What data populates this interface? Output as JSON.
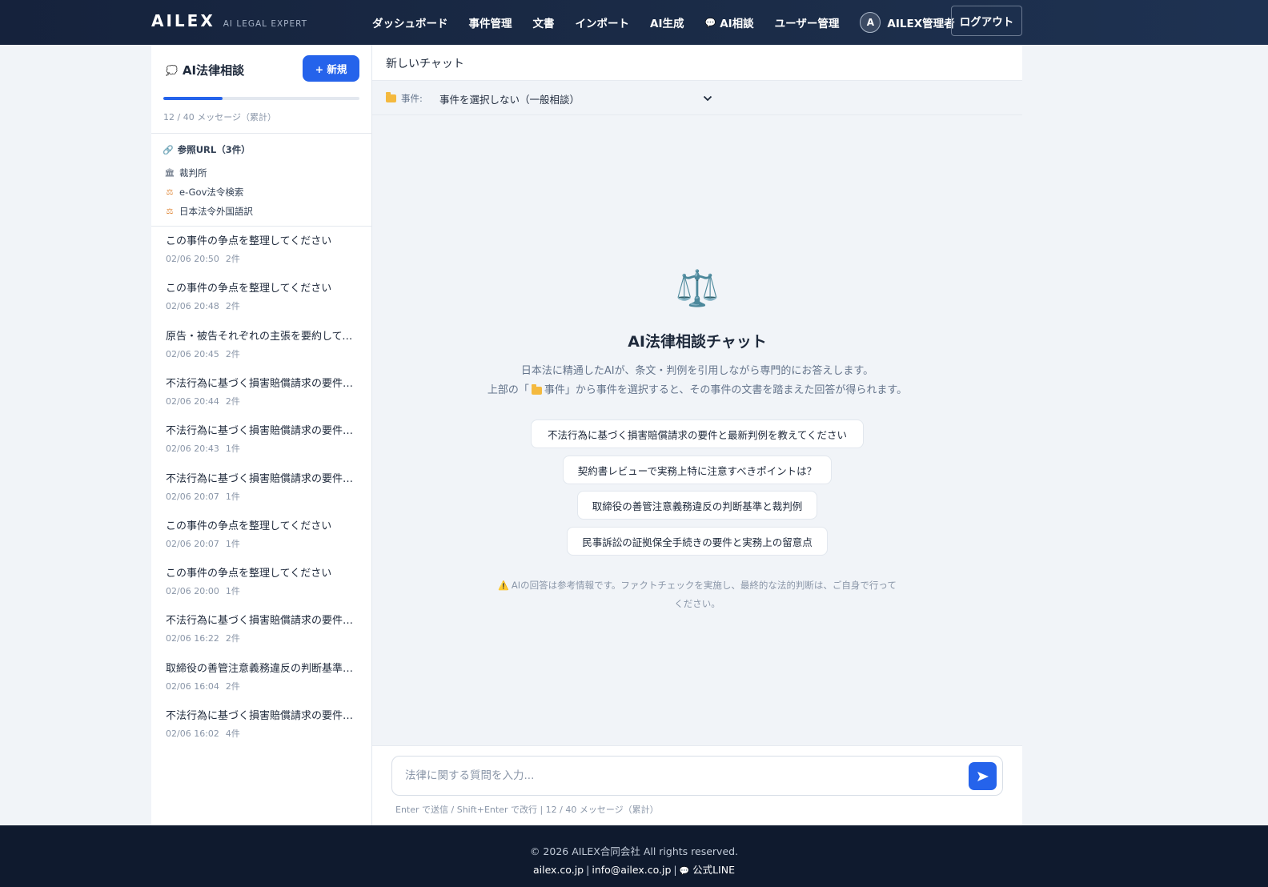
{
  "header": {
    "logo": "AILEX",
    "tagline": "AI LEGAL EXPERT",
    "nav": [
      "ダッシュボード",
      "事件管理",
      "文書",
      "インポート",
      "AI生成",
      "AI相談",
      "ユーザー管理"
    ],
    "user": {
      "initial": "A",
      "name": "AILEX管理者"
    },
    "logout": "ログアウト"
  },
  "sidebar": {
    "title": "AI法律相談",
    "new_button": "+ 新規",
    "usage": {
      "used": 12,
      "limit": 40,
      "progress": 0.3,
      "text": "12 / 40 メッセージ（累計）"
    },
    "refs_title": "参照URL（3件）",
    "refs": [
      {
        "label": "裁判所",
        "icon": "court-icon"
      },
      {
        "label": "e-Gov法令検索",
        "icon": "law-icon"
      },
      {
        "label": "日本法令外国語訳",
        "icon": "law-icon"
      }
    ],
    "history": [
      {
        "title": "この事件の争点を整理してください",
        "time": "02/06 20:50",
        "count": "2件"
      },
      {
        "title": "この事件の争点を整理してください",
        "time": "02/06 20:48",
        "count": "2件"
      },
      {
        "title": "原告・被告それぞれの主張を要約してください",
        "time": "02/06 20:45",
        "count": "2件"
      },
      {
        "title": "不法行為に基づく損害賠償請求の要件と最新判例を教えてください",
        "time": "02/06 20:44",
        "count": "2件"
      },
      {
        "title": "不法行為に基づく損害賠償請求の要件と最新判例を教えてください",
        "time": "02/06 20:43",
        "count": "1件"
      },
      {
        "title": "不法行為に基づく損害賠償請求の要件と最新判例を教えてください",
        "time": "02/06 20:07",
        "count": "1件"
      },
      {
        "title": "この事件の争点を整理してください",
        "time": "02/06 20:07",
        "count": "1件"
      },
      {
        "title": "この事件の争点を整理してください",
        "time": "02/06 20:00",
        "count": "1件"
      },
      {
        "title": "不法行為に基づく損害賠償請求の要件と最新判例を教えてください",
        "time": "02/06 16:22",
        "count": "2件"
      },
      {
        "title": "取締役の善管注意義務違反の判断基準と裁判例",
        "time": "02/06 16:04",
        "count": "2件"
      },
      {
        "title": "不法行為に基づく損害賠償請求の要件と最新判例を教えてください",
        "time": "02/06 16:02",
        "count": "4件"
      }
    ]
  },
  "main": {
    "chat_title": "新しいチャット",
    "case_label": "事件:",
    "case_selected": "事件を選択しない（一般相談）",
    "welcome_title": "AI法律相談チャット",
    "welcome_line1": "日本法に精通したAIが、条文・判例を引用しながら専門的にお答えします。",
    "welcome_line2_pre": "上部の「",
    "welcome_line2_mid": "事件」から事件を選択すると、その事件の文書を踏まえた回答が得られます。",
    "suggestions": [
      "不法行為に基づく損害賠償請求の要件と最新判例を教えてください",
      "契約書レビューで実務上特に注意すべきポイントは？",
      "取締役の善管注意義務違反の判断基準と裁判例",
      "民事訴訟の証拠保全手続きの要件と実務上の留意点"
    ],
    "disclaimer": "AIの回答は参考情報です。ファクトチェックを実施し、最終的な法的判断は、ご自身で行ってください。",
    "input_placeholder": "法律に関する質問を入力...",
    "input_hint": "Enter で送信 / Shift+Enter で改行 | 12 / 40 メッセージ（累計）"
  },
  "footer": {
    "copyright": "© 2026 AILEX合同会社 All rights reserved.",
    "site": "ailex.co.jp",
    "email": "info@ailex.co.jp",
    "line": "公式LINE"
  },
  "colors": {
    "accent": "#2563eb",
    "header_bg": "#1b2c48",
    "footer_bg": "#0f1a2e"
  }
}
